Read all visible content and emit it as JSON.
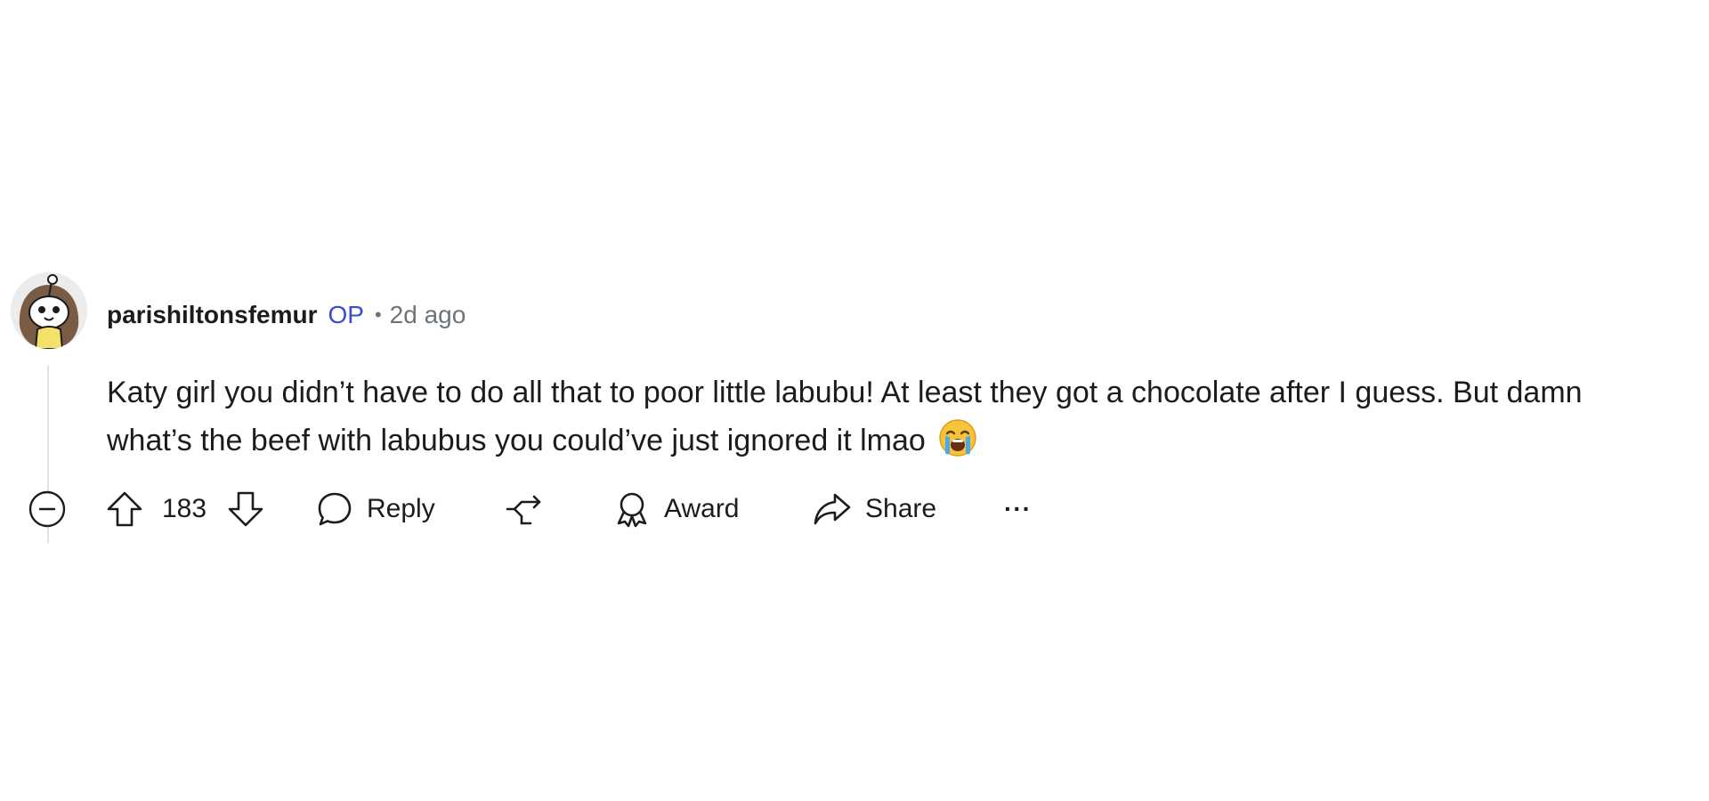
{
  "comment": {
    "author": "parishiltonsfemur",
    "op_badge": "OP",
    "separator": "•",
    "timestamp": "2d ago",
    "body": "Katy girl you didn’t have to do all that to poor little labubu! At least they got a chocolate after I guess. But damn what’s the beef with labubus you could’ve just ignored it lmao",
    "emoji": "loudly-crying-face"
  },
  "actions": {
    "score": "183",
    "reply_label": "Reply",
    "award_label": "Award",
    "share_label": "Share",
    "more_label": "···"
  },
  "colors": {
    "op_badge": "#3a4ccf",
    "muted_text": "#6d7478",
    "thread_line": "#dfe3e6"
  }
}
